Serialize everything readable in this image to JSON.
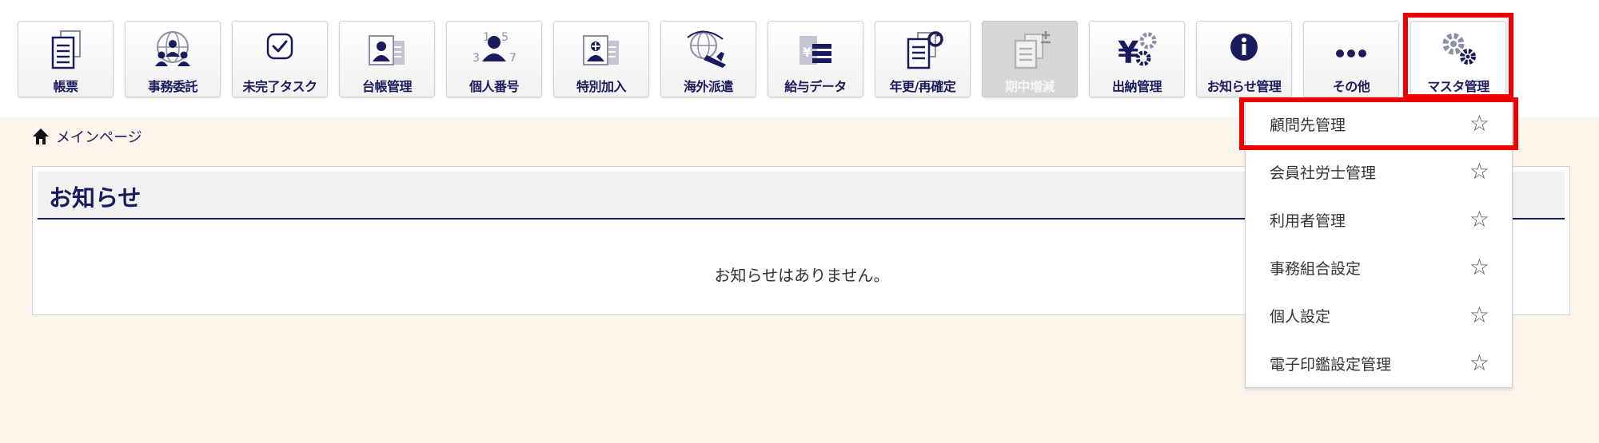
{
  "toolbar": {
    "items": [
      {
        "label": "帳票",
        "icon": "document-list-icon"
      },
      {
        "label": "事務委託",
        "icon": "globe-people-icon"
      },
      {
        "label": "未完了タスク",
        "icon": "checkbox-task-icon"
      },
      {
        "label": "台帳管理",
        "icon": "id-card-icon"
      },
      {
        "label": "個人番号",
        "icon": "person-number-icon"
      },
      {
        "label": "特別加入",
        "icon": "special-card-icon"
      },
      {
        "label": "海外派遣",
        "icon": "globe-airplane-icon"
      },
      {
        "label": "給与データ",
        "icon": "salary-data-icon"
      },
      {
        "label": "年更/再確定",
        "icon": "document-refresh-icon"
      },
      {
        "label": "期中増減",
        "icon": "document-plus-minus-icon"
      },
      {
        "label": "出納管理",
        "icon": "yen-gear-icon"
      },
      {
        "label": "お知らせ管理",
        "icon": "info-icon"
      },
      {
        "label": "その他",
        "icon": "ellipsis-icon"
      },
      {
        "label": "マスタ管理",
        "icon": "gears-icon"
      }
    ]
  },
  "breadcrumb": {
    "icon": "home-icon",
    "label": "メインページ"
  },
  "notice": {
    "title": "お知らせ",
    "empty_text": "お知らせはありません。"
  },
  "dropdown": {
    "items": [
      {
        "label": "顧問先管理"
      },
      {
        "label": "会員社労士管理"
      },
      {
        "label": "利用者管理"
      },
      {
        "label": "事務組合設定"
      },
      {
        "label": "個人設定"
      },
      {
        "label": "電子印鑑設定管理"
      }
    ],
    "star_glyph": "☆"
  },
  "colors": {
    "navy": "#1a1a5e",
    "highlight": "#ee0000",
    "background": "#fdf5ec",
    "disabled": "#d6d6d6"
  }
}
